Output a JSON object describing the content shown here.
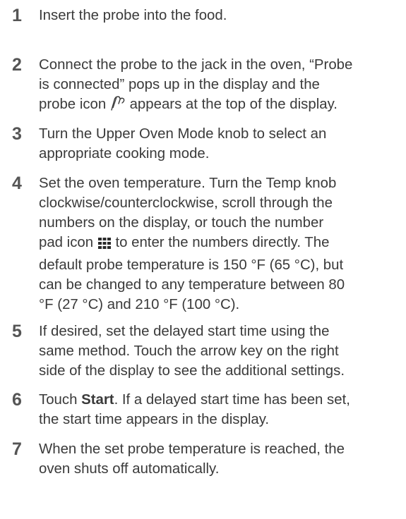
{
  "steps": [
    {
      "number": "1",
      "lines": [
        "Insert the probe into the food."
      ]
    },
    {
      "number": "2",
      "lines": [
        "Connect the probe to the jack in the oven, “Probe",
        "is connected” pops up in the display and the"
      ],
      "line3_before": "probe icon",
      "line3_after": "appears at the top of the display.",
      "icon": "probe-icon"
    },
    {
      "number": "3",
      "lines": [
        "Turn the Upper Oven Mode knob to select an",
        "appropriate cooking mode."
      ]
    },
    {
      "number": "4",
      "lines": [
        "Set the oven temperature. Turn the Temp knob",
        "clockwise/counterclockwise, scroll through the",
        "numbers on the display, or touch the number"
      ],
      "line4_before": "pad icon",
      "line4_after": "to enter the numbers directly. The",
      "icon": "number-pad-icon",
      "rest": [
        "default probe temperature is 150 °F (65 °C), but",
        "can be changed to any temperature between 80",
        "°F (27 °C) and 210 °F (100 °C)."
      ]
    },
    {
      "number": "5",
      "lines": [
        "If desired, set the delayed start time using the",
        "same method. Touch the arrow key on the right",
        "side of the display to see the additional settings."
      ]
    },
    {
      "number": "6",
      "line1_before": "Touch",
      "line1_bold": "Start",
      "line1_after": ". If a delayed start time has been set,",
      "lines": [
        "the start time appears in the display."
      ]
    },
    {
      "number": "7",
      "lines": [
        "When the set probe temperature is reached, the",
        "oven shuts off automatically."
      ]
    }
  ]
}
